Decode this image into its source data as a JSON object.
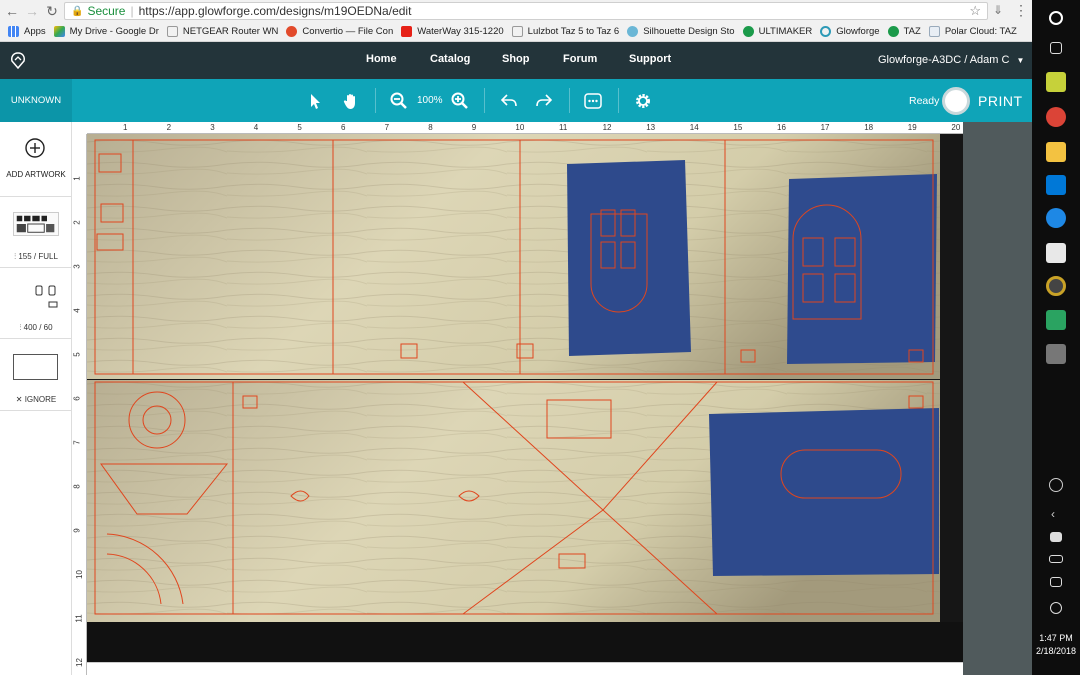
{
  "browser": {
    "secure_label": "Secure",
    "url": "https://app.glowforge.com/designs/m19OEDNa/edit",
    "bookmarks": [
      "Apps",
      "My Drive - Google Dr",
      "NETGEAR Router WN",
      "Convertio — File Con",
      "WaterWay 315-1220",
      "Lulzbot Taz 5 to Taz 6",
      "Silhouette Design Sto",
      "ULTIMAKER",
      "Glowforge",
      "TAZ",
      "Polar Cloud: TAZ"
    ]
  },
  "header": {
    "nav": [
      "Home",
      "Catalog",
      "Shop",
      "Forum",
      "Support"
    ],
    "device": "Glowforge-A3DC",
    "separator": "/",
    "user": "Adam C"
  },
  "toolbar": {
    "material": "UNKNOWN",
    "zoom": "100%",
    "status": "Ready",
    "print_label": "PRINT"
  },
  "left_panel": {
    "add_label": "ADD ARTWORK",
    "setting1": "155 / FULL",
    "setting2": "400 / 60",
    "ignore_label": "IGNORE"
  },
  "rulers": {
    "horizontal": [
      "1",
      "2",
      "3",
      "4",
      "5",
      "6",
      "7",
      "8",
      "9",
      "10",
      "11",
      "12",
      "13",
      "14",
      "15",
      "16",
      "17",
      "18",
      "19",
      "20"
    ],
    "vertical": [
      "1",
      "2",
      "3",
      "4",
      "5",
      "6",
      "7",
      "8",
      "9",
      "10",
      "11",
      "12"
    ]
  },
  "taskbar": {
    "time": "1:47 PM",
    "date": "2/18/2018"
  },
  "colors": {
    "header_bg": "#23343a",
    "toolbar_bg": "#0fa4b8",
    "cut_line": "#e0461e",
    "masking": "#2e4a8c"
  }
}
